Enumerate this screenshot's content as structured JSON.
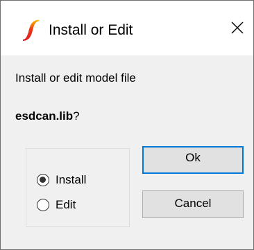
{
  "window": {
    "title": "Install or Edit",
    "app_icon": "ltspice-logo-icon",
    "close_icon": "close-icon"
  },
  "message": {
    "line1": "Install or edit model file",
    "filename": "esdcan.lib",
    "suffix": "?"
  },
  "options": {
    "items": [
      {
        "label": "Install",
        "checked": true
      },
      {
        "label": "Edit",
        "checked": false
      }
    ]
  },
  "buttons": {
    "ok_label": "Ok",
    "cancel_label": "Cancel"
  },
  "colors": {
    "accent": "#0078d7",
    "icon_red": "#e01a22",
    "icon_yellow": "#f5b800",
    "client_bg": "#f0f0f0"
  }
}
